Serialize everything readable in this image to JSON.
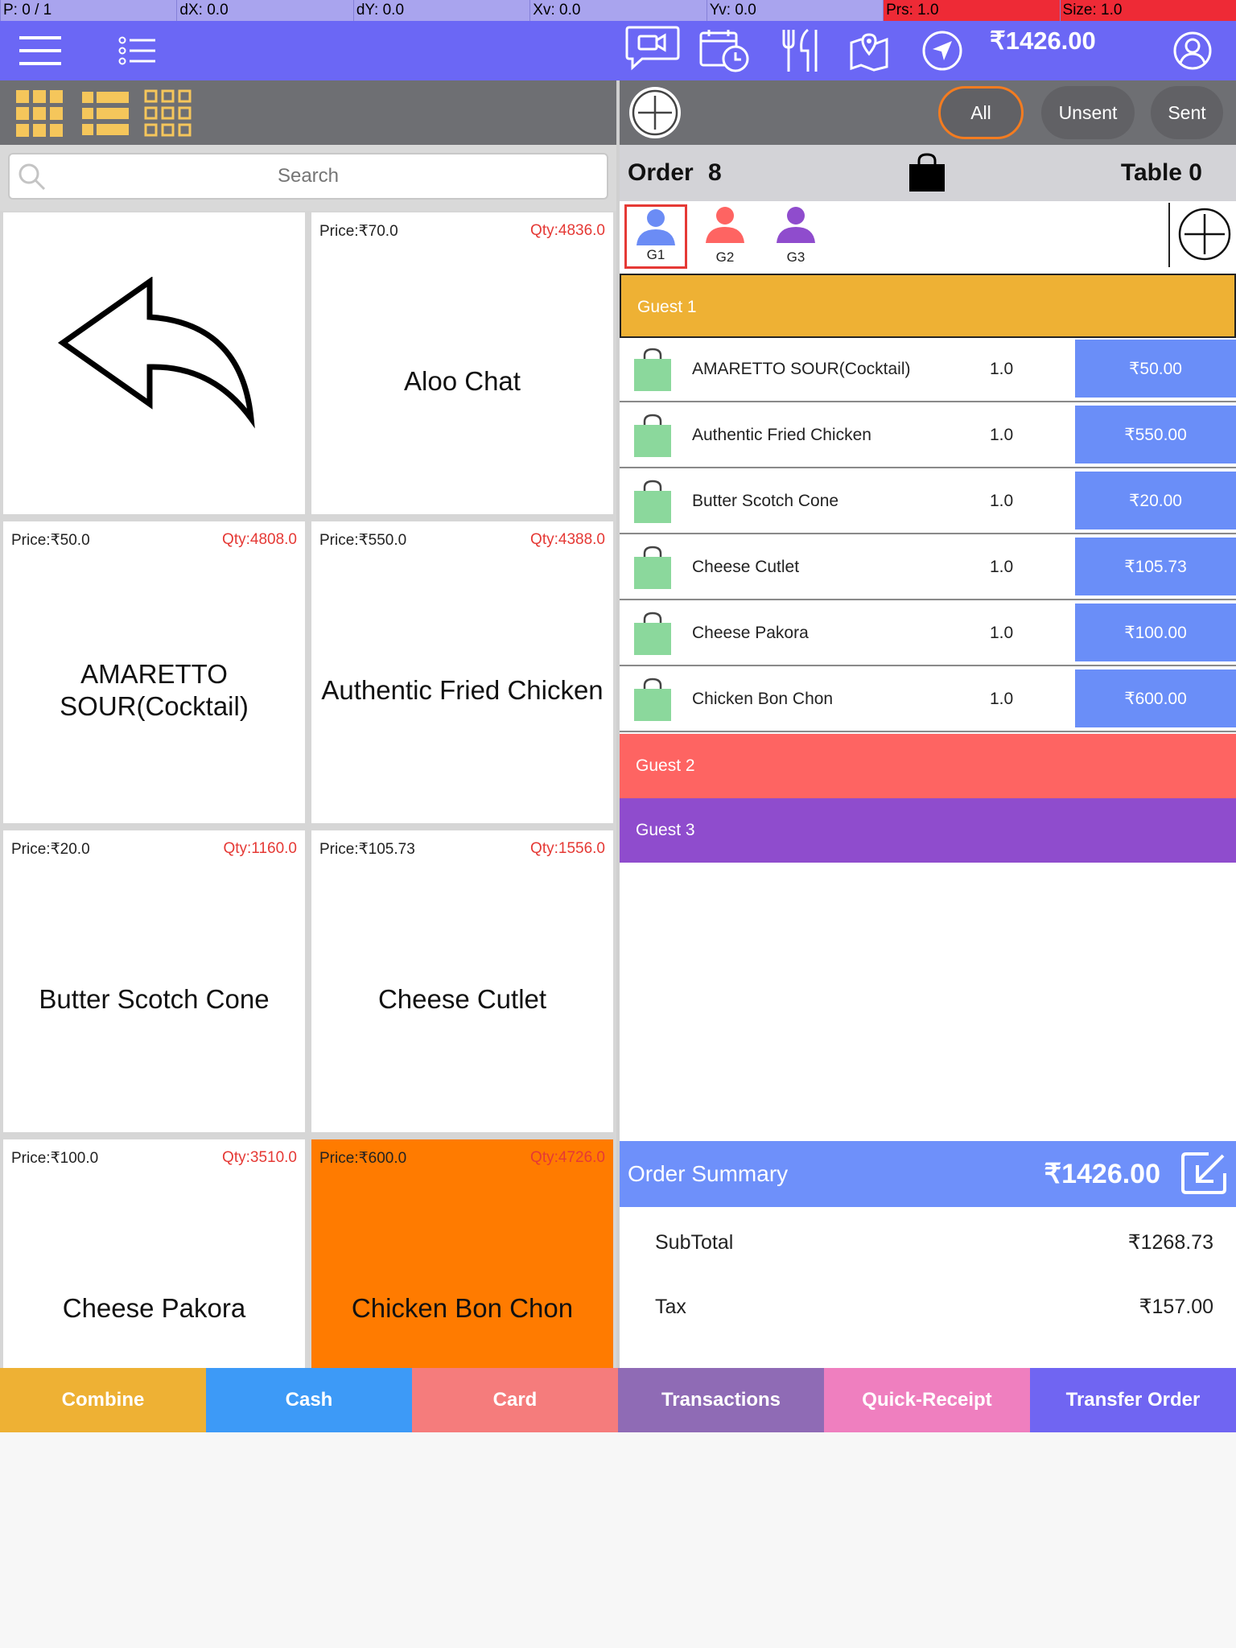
{
  "debug_bar": [
    {
      "label": "P: 0 / 1"
    },
    {
      "label": "dX: 0.0"
    },
    {
      "label": "dY: 0.0"
    },
    {
      "label": "Xv: 0.0"
    },
    {
      "label": "Yv: 0.0"
    },
    {
      "label": "Prs: 1.0"
    },
    {
      "label": "Size: 1.0"
    }
  ],
  "header": {
    "total": "₹1426.00",
    "icons": [
      "menu-icon",
      "list-icon",
      "video-chat-icon",
      "calendar-clock-icon",
      "restaurant-icon",
      "map-pin-icon",
      "navigation-icon",
      "user-icon"
    ]
  },
  "toolbar": {
    "filters": [
      {
        "label": "All",
        "active": true
      },
      {
        "label": "Unsent",
        "active": false
      },
      {
        "label": "Sent",
        "active": false
      }
    ]
  },
  "search": {
    "placeholder": "Search"
  },
  "products": [
    {
      "type": "back"
    },
    {
      "name": "Aloo Chat",
      "price": "Price:₹70.0",
      "qty": "Qty:4836.0"
    },
    {
      "name": "AMARETTO SOUR(Cocktail)",
      "price": "Price:₹50.0",
      "qty": "Qty:4808.0"
    },
    {
      "name": "Authentic Fried Chicken",
      "price": "Price:₹550.0",
      "qty": "Qty:4388.0"
    },
    {
      "name": "Butter Scotch Cone",
      "price": "Price:₹20.0",
      "qty": "Qty:1160.0"
    },
    {
      "name": "Cheese Cutlet",
      "price": "Price:₹105.73",
      "qty": "Qty:1556.0"
    },
    {
      "name": "Cheese Pakora",
      "price": "Price:₹100.0",
      "qty": "Qty:3510.0"
    },
    {
      "name": "Chicken Bon Chon",
      "price": "Price:₹600.0",
      "qty": "Qty:4726.0",
      "highlight": true
    }
  ],
  "order": {
    "label": "Order",
    "number": "8",
    "table": "Table 0",
    "guest_tabs": [
      {
        "label": "G1",
        "color": "#6b8cf5",
        "selected": true
      },
      {
        "label": "G2",
        "color": "#fe6462",
        "selected": false
      },
      {
        "label": "G3",
        "color": "#8f4ccd",
        "selected": false
      }
    ],
    "guests": [
      {
        "name": "Guest 1",
        "color": "#eeb134"
      },
      {
        "name": "Guest 2",
        "color": "#fe6462"
      },
      {
        "name": "Guest 3",
        "color": "#8f4ccd"
      }
    ],
    "items": [
      {
        "name": "AMARETTO SOUR(Cocktail)",
        "qty": "1.0",
        "price": "₹50.00"
      },
      {
        "name": "Authentic Fried Chicken",
        "qty": "1.0",
        "price": "₹550.00"
      },
      {
        "name": "Butter Scotch Cone",
        "qty": "1.0",
        "price": "₹20.00"
      },
      {
        "name": "Cheese Cutlet",
        "qty": "1.0",
        "price": "₹105.73"
      },
      {
        "name": "Cheese Pakora",
        "qty": "1.0",
        "price": "₹100.00"
      },
      {
        "name": "Chicken Bon Chon",
        "qty": "1.0",
        "price": "₹600.00"
      }
    ]
  },
  "summary": {
    "title": "Order Summary",
    "total": "₹1426.00",
    "rows": [
      {
        "label": "SubTotal",
        "value": "₹1268.73"
      },
      {
        "label": "Tax",
        "value": "₹157.00"
      }
    ]
  },
  "actions": [
    {
      "label": "Combine",
      "color": "#eeb134"
    },
    {
      "label": "Cash",
      "color": "#3d9af7"
    },
    {
      "label": "Card",
      "color": "#f57c7c"
    },
    {
      "label": "Transactions",
      "color": "#8f6bb5"
    },
    {
      "label": "Quick-Receipt",
      "color": "#ef7fbf"
    },
    {
      "label": "Transfer Order",
      "color": "#7065f2"
    }
  ]
}
